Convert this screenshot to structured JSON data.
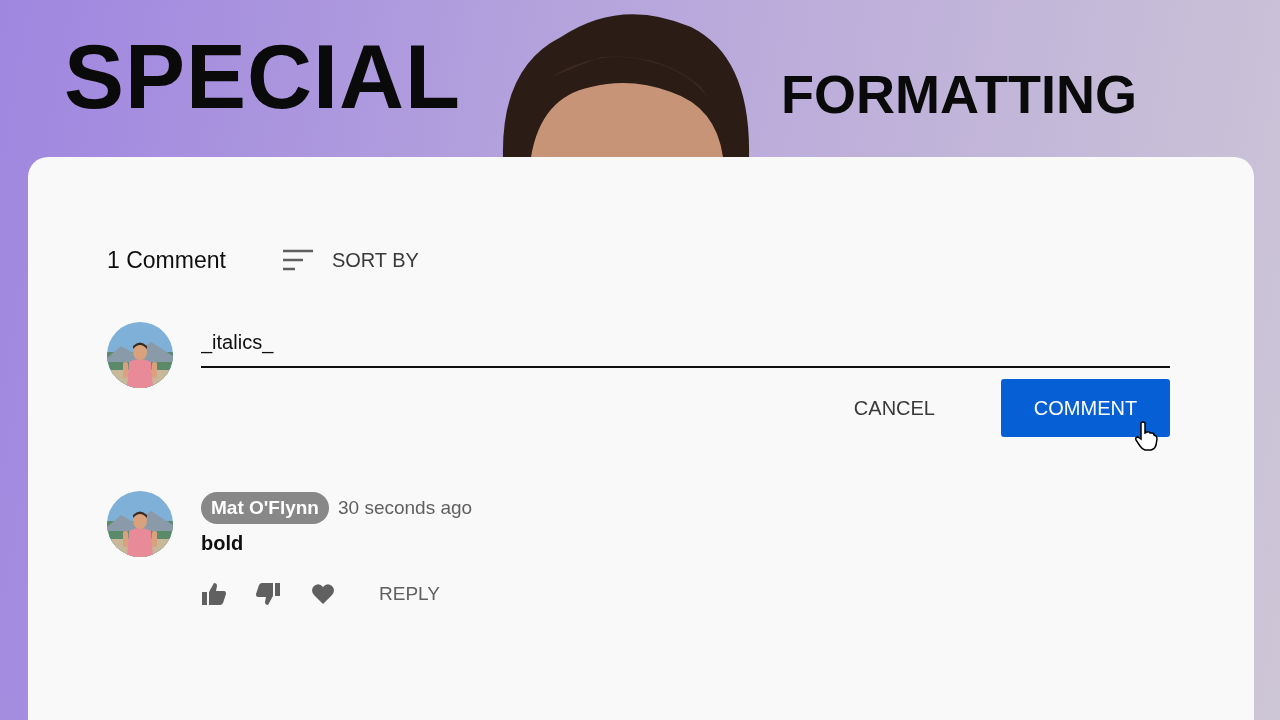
{
  "headline": {
    "left": "SPECIAL",
    "right": "FORMATTING"
  },
  "comments_header": {
    "count": "1 Comment",
    "sort_label": "SORT BY"
  },
  "composer": {
    "value": "_italics_",
    "buttons": [
      {
        "label": "CANCEL",
        "kind": "text"
      },
      {
        "label": "COMMENT",
        "kind": "primary"
      }
    ]
  },
  "comments": [
    {
      "author": "Mat O'Flynn",
      "author_highlighted": true,
      "time": "30 seconds ago",
      "text": "bold",
      "reply_label": "REPLY"
    }
  ]
}
